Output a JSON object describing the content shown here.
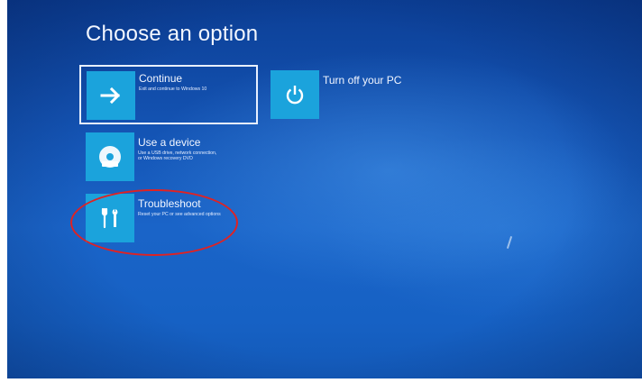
{
  "screen": {
    "title": "Choose an option"
  },
  "options": {
    "continue": {
      "label": "Continue",
      "description": "Exit and continue to Windows 10"
    },
    "turn_off": {
      "label": "Turn off your PC"
    },
    "use_device": {
      "label": "Use a device",
      "description_line1": "Use a USB drive, network connection,",
      "description_line2": "or Windows recovery DVD"
    },
    "troubleshoot": {
      "label": "Troubleshoot",
      "description": "Reset your PC or see advanced options"
    }
  },
  "colors": {
    "background": "#1661c4",
    "tile": "#1ba3dc",
    "highlight_annotation": "#e12222"
  },
  "icons": {
    "continue": "arrow-right-icon",
    "turn_off": "power-icon",
    "use_device": "disc-drive-icon",
    "troubleshoot": "tools-icon"
  }
}
